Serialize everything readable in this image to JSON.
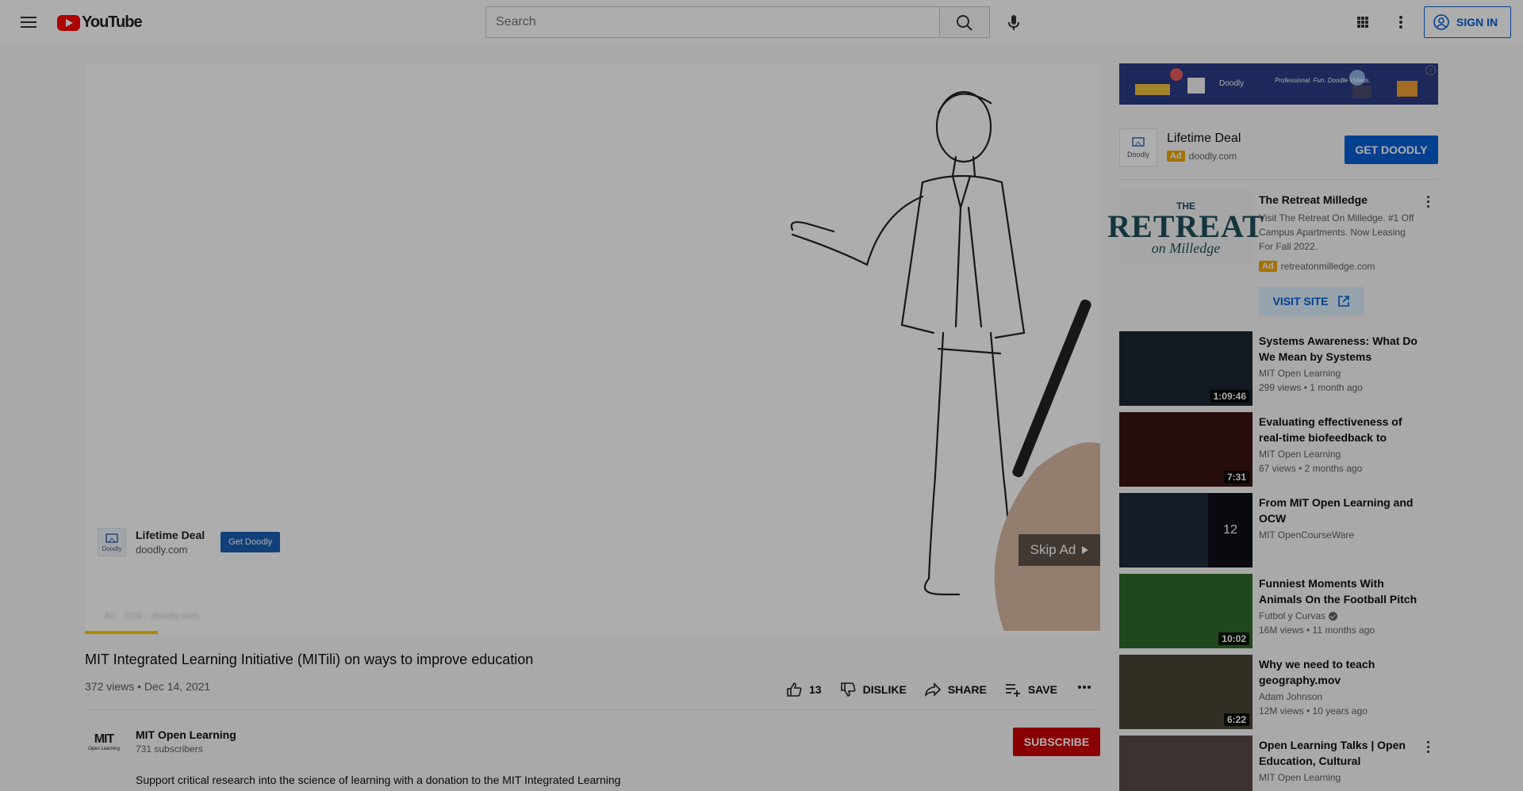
{
  "header": {
    "logo_text": "YouTube",
    "search_placeholder": "Search",
    "signin_label": "SIGN IN"
  },
  "player": {
    "ad": {
      "title": "Lifetime Deal",
      "domain": "doodly.com",
      "cta": "Get Doodly",
      "logo_text": "Doodly"
    },
    "skip_label": "Skip Ad",
    "ad_badge": "Ad · 0:05 · doodly.com",
    "progress": 0.072
  },
  "video": {
    "title": "MIT Integrated Learning Initiative (MITili) on ways to improve education",
    "meta": "372 views • Dec 14, 2021",
    "likes": "13",
    "dislike_label": "DISLIKE",
    "share_label": "SHARE",
    "save_label": "SAVE"
  },
  "channel": {
    "avatar_text": "MIT",
    "avatar_sub": "Open Learning",
    "name": "MIT Open Learning",
    "subscribers": "731 subscribers",
    "subscribe_label": "SUBSCRIBE",
    "description": "Support critical research into the science of learning with a donation to the MIT Integrated Learning"
  },
  "sidebar": {
    "banner": {
      "logo": "Doodly",
      "tagline": "Professional. Fun. Doodle Videos."
    },
    "companion": {
      "title": "Lifetime Deal",
      "ad_label": "Ad",
      "domain": "doodly.com",
      "cta": "GET DOODLY",
      "logo_text": "Doodly"
    },
    "promo": {
      "thumb_small": "THE",
      "thumb_big": "RETREAT",
      "thumb_script": "on Milledge",
      "title": "The Retreat Milledge",
      "description": "Visit The Retreat On Milledge. #1 Off Campus Apartments. Now Leasing For Fall 2022.",
      "ad_label": "Ad",
      "domain": "retreatonmilledge.com",
      "cta": "VISIT SITE"
    },
    "recommendations": [
      {
        "title": "Systems Awareness: What Do We Mean by Systems Change?",
        "channel": "MIT Open Learning",
        "stats": "299 views • 1 month ago",
        "duration": "1:09:46",
        "verified": false,
        "thumb_color": "#1c2630"
      },
      {
        "title": "Evaluating effectiveness of real-time biofeedback to monitor &...",
        "channel": "MIT Open Learning",
        "stats": "67 views • 2 months ago",
        "duration": "7:31",
        "verified": false,
        "thumb_color": "#3a1414"
      },
      {
        "title": "From MIT Open Learning and OCW",
        "channel": "MIT OpenCourseWare",
        "stats": "",
        "duration": "",
        "playlist_count": "12",
        "verified": false,
        "thumb_color": "#20283a"
      },
      {
        "title": "Funniest Moments With Animals On the Football Pitch",
        "channel": "Futbol y Curvas",
        "stats": "16M views • 11 months ago",
        "duration": "10:02",
        "verified": true,
        "thumb_color": "#2f6a2a"
      },
      {
        "title": "Why we need to teach geography.mov",
        "channel": "Adam Johnson",
        "stats": "12M views • 10 years ago",
        "duration": "6:22",
        "verified": false,
        "thumb_color": "#4a4436"
      },
      {
        "title": "Open Learning Talks | Open Education, Cultural Collection,...",
        "channel": "MIT Open Learning",
        "stats": "",
        "duration": "",
        "verified": false,
        "thumb_color": "#5a4a4a"
      }
    ]
  }
}
